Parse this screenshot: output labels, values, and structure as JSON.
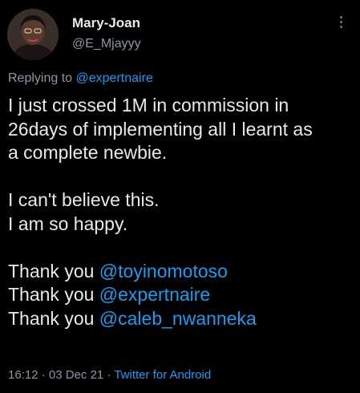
{
  "author": {
    "display_name": "Mary-Joan",
    "handle": "@E_Mjayyy"
  },
  "reply_context": {
    "prefix": "Replying to ",
    "mention": "@expertnaire"
  },
  "tweet_text": {
    "paragraph1": [
      "I just crossed 1M in commission in",
      "26days of implementing all I learnt as",
      "a complete newbie."
    ],
    "paragraph2": [
      "I can't believe this.",
      "I am so happy."
    ],
    "thanks": [
      {
        "prefix": "Thank you ",
        "mention": "@toyinomotoso"
      },
      {
        "prefix": "Thank you ",
        "mention": "@expertnaire"
      },
      {
        "prefix": "Thank you ",
        "mention": "@caleb_nwanneka"
      }
    ]
  },
  "meta": {
    "time": "16:12",
    "separator": " · ",
    "date": "03 Dec 21",
    "source": "Twitter for Android"
  },
  "icons": {
    "more": "more-options-icon",
    "avatar": "profile-photo"
  },
  "colors": {
    "background": "#000000",
    "text": "#e7e9ea",
    "secondary": "#8b98a5",
    "link": "#1d9bf0"
  }
}
